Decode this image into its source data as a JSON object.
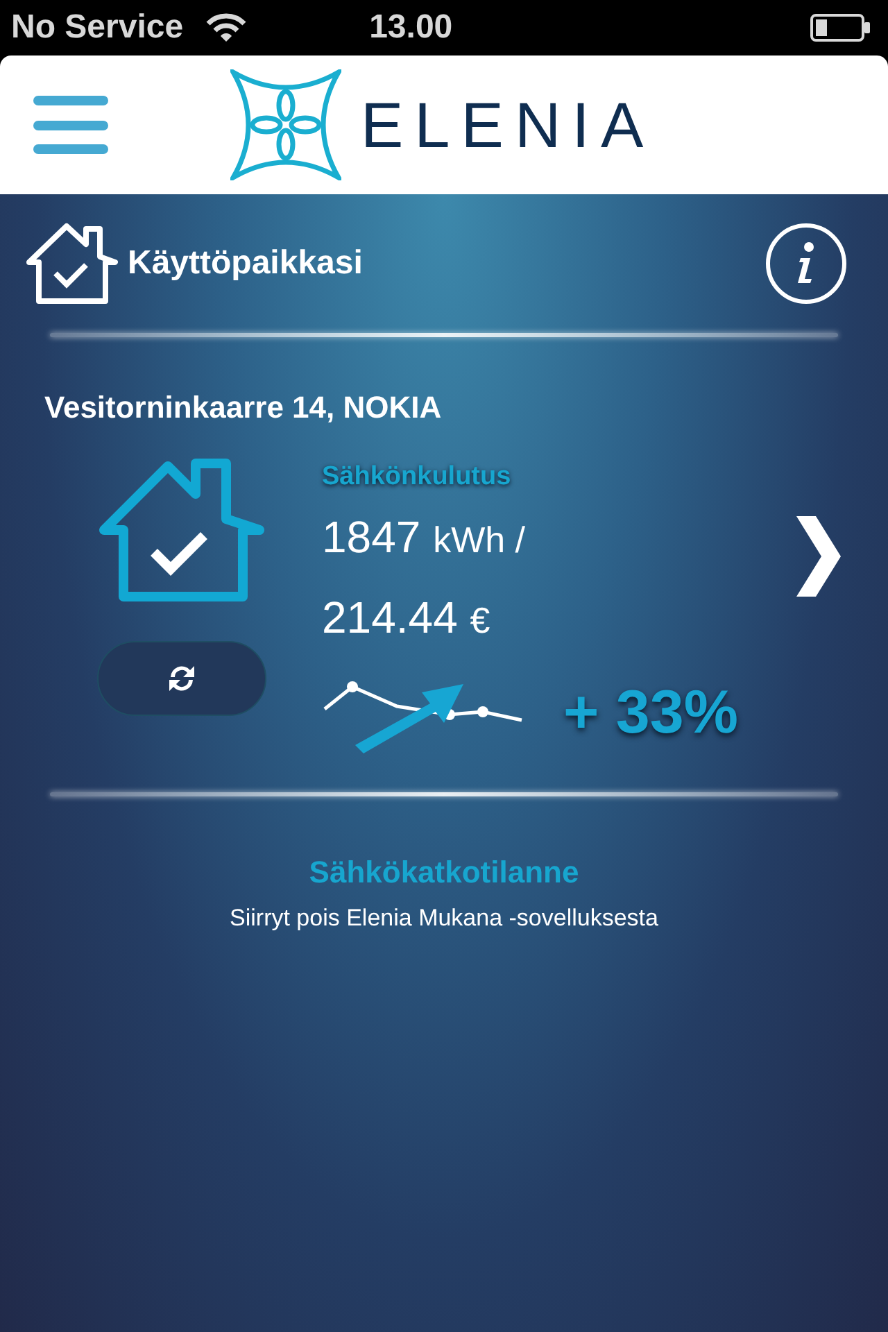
{
  "status_bar": {
    "carrier": "No Service",
    "time": "13.00"
  },
  "header": {
    "logo_text": "ELENIA"
  },
  "section": {
    "title": "Käyttöpaikkasi"
  },
  "site": {
    "address": "Vesitorninkaarre 14, NOKIA",
    "label": "Sähkönkulutus",
    "energy_value": "1847",
    "energy_unit": "kWh /",
    "cost_value": "214.44",
    "cost_unit": "€",
    "change": "+ 33%"
  },
  "outage": {
    "link": "Sähkökatkotilanne",
    "note": "Siirryt pois Elenia Mukana -sovelluksesta"
  }
}
